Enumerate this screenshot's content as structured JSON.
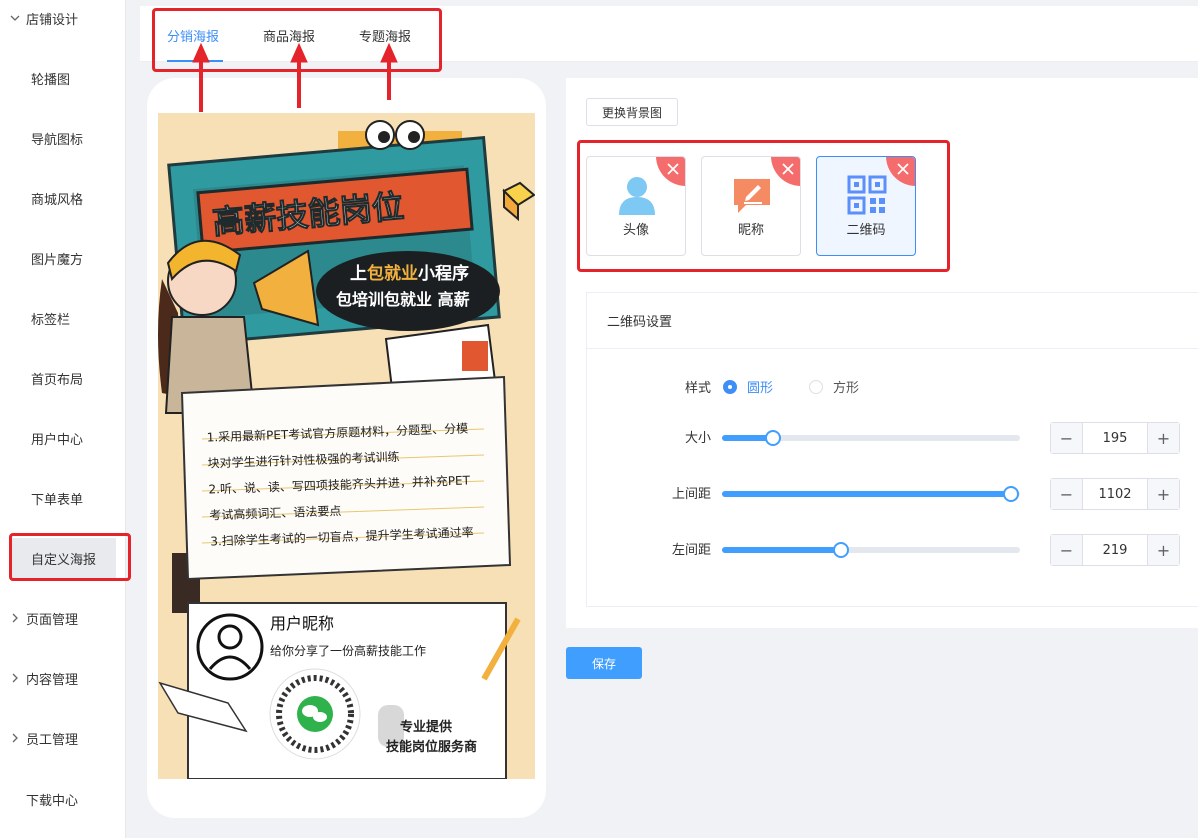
{
  "sidebar": {
    "group_top": "店铺设计",
    "items": [
      "轮播图",
      "导航图标",
      "商城风格",
      "图片魔方",
      "标签栏",
      "首页布局",
      "用户中心",
      "下单表单",
      "自定义海报"
    ],
    "groups": [
      "页面管理",
      "内容管理",
      "员工管理"
    ],
    "download": "下载中心"
  },
  "tabs": [
    "分销海报",
    "商品海报",
    "专题海报"
  ],
  "poster": {
    "headline": "高薪技能岗位",
    "bubble_line1_a": "上",
    "bubble_line1_b": "包就业",
    "bubble_line1_c": "小程序",
    "bubble_line2": "包培训包就业 高薪",
    "point1a": "1.采用最新PET考试官方原题材料，分题型、分模",
    "point1b": "块对学生进行针对性极强的考试训练",
    "point2a": "2.听、说、读、写四项技能齐头并进，并补充PET",
    "point2b": "考试高频词汇、语法要点",
    "point3": "3.扫除学生考试的一切盲点，提升学生考试通过率",
    "nickname": "用户昵称",
    "share_text": "给你分享了一份高薪技能工作",
    "provider1": "专业提供",
    "provider2": "技能岗位服务商"
  },
  "panel": {
    "bg_button": "更换背景图",
    "elements": [
      {
        "label": "头像",
        "icon": "avatar-icon"
      },
      {
        "label": "昵称",
        "icon": "nickname-icon"
      },
      {
        "label": "二维码",
        "icon": "qrcode-icon"
      }
    ],
    "settings_title": "二维码设置",
    "style_label": "样式",
    "style_options": [
      "圆形",
      "方形"
    ],
    "style_selected": "圆形",
    "sliders": [
      {
        "label": "大小",
        "value": "195",
        "ratio": 0.17
      },
      {
        "label": "上间距",
        "value": "1102",
        "ratio": 0.97
      },
      {
        "label": "左间距",
        "value": "219",
        "ratio": 0.4
      }
    ],
    "save": "保存"
  },
  "colors": {
    "accent": "#409eff",
    "annotation": "#e5232b",
    "delete_corner": "#f56c6c"
  }
}
